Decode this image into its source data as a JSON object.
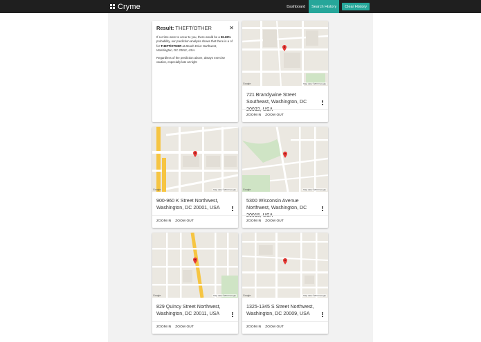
{
  "app": {
    "name": "Cryme",
    "logo_icon": "grid-icon"
  },
  "nav": {
    "dashboard": "Dashboard",
    "search_history": "Search History",
    "clear_history": "Clear History"
  },
  "colors": {
    "topbar": "#1f1f1f",
    "accent": "#26a69a",
    "panel": "#f2f2f2",
    "pin": "#e53935"
  },
  "result": {
    "label": "Result:",
    "type": "THEFT/OTHER",
    "close_icon": "close-icon",
    "text_a": "If a crime were to occur to you, there would be a ",
    "percent": "36.26%",
    "text_b": " probability, our prediction analysis shows that there is a of for ",
    "type_bold": "THEFT/OTHER",
    "text_c": " at ",
    "location": "Beach Drive Northwest, Washington, DC 20011, USA",
    "text_d": ".",
    "note": "Regardless of the prediction above, always exercise caution, especially late at night"
  },
  "map_credit": "Map data ©2015 Google",
  "google_mark": "Google",
  "cards": [
    {
      "address": "721 Brandywine Street Southeast, Washington, DC 20032, USA",
      "zoom_in": "ZOOM IN",
      "zoom_out": "ZOOM OUT"
    },
    {
      "address": "900-960 K Street Northwest, Washington, DC 20001, USA",
      "zoom_in": "ZOOM IN",
      "zoom_out": "ZOOM OUT"
    },
    {
      "address": "5300 Wisconsin Avenue Northwest, Washington, DC 20015, USA",
      "zoom_in": "ZOOM IN",
      "zoom_out": "ZOOM OUT"
    },
    {
      "address": "829 Quincy Street Northwest, Washington, DC 20011, USA",
      "zoom_in": "ZOOM IN",
      "zoom_out": "ZOOM OUT"
    },
    {
      "address": "1325-1345 S Street Northwest, Washington, DC 20009, USA",
      "zoom_in": "ZOOM IN",
      "zoom_out": "ZOOM OUT"
    }
  ]
}
